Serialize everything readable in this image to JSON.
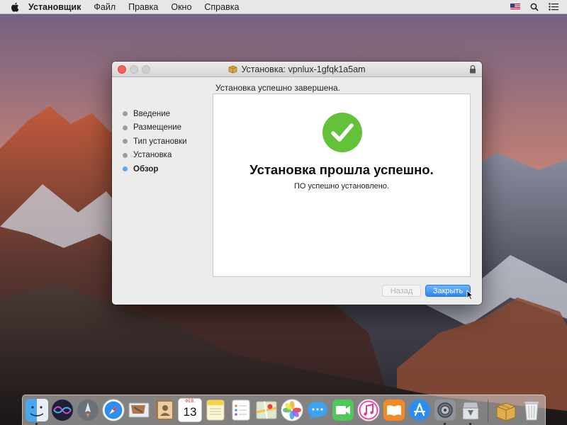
{
  "menubar": {
    "app_name": "Установщик",
    "items": [
      "Файл",
      "Правка",
      "Окно",
      "Справка"
    ]
  },
  "window": {
    "title": "Установка: vpnlux-1gfqk1a5am",
    "heading": "Установка успешно завершена.",
    "steps": [
      {
        "label": "Введение",
        "active": false
      },
      {
        "label": "Размещение",
        "active": false
      },
      {
        "label": "Тип установки",
        "active": false
      },
      {
        "label": "Установка",
        "active": false
      },
      {
        "label": "Обзор",
        "active": true
      }
    ],
    "success_title": "Установка прошла успешно.",
    "success_subtitle": "ПО успешно установлено.",
    "buttons": {
      "back": "Назад",
      "close": "Закрыть"
    }
  },
  "dock": {
    "calendar_month": "ФЕВ.",
    "calendar_day": "13",
    "icons": [
      "finder-icon",
      "siri-icon",
      "launchpad-icon",
      "safari-icon",
      "mail-icon",
      "contacts-icon",
      "calendar-icon",
      "notes-icon",
      "reminders-icon",
      "maps-icon",
      "photos-icon",
      "messages-icon",
      "facetime-icon",
      "itunes-icon",
      "ibooks-icon",
      "app-store-icon",
      "system-preferences-icon",
      "installer-icon",
      "downloads-icon",
      "trash-icon"
    ]
  },
  "colors": {
    "accent": "#2f86f4",
    "success": "#64c23a",
    "active_step": "#5ea8ec"
  }
}
